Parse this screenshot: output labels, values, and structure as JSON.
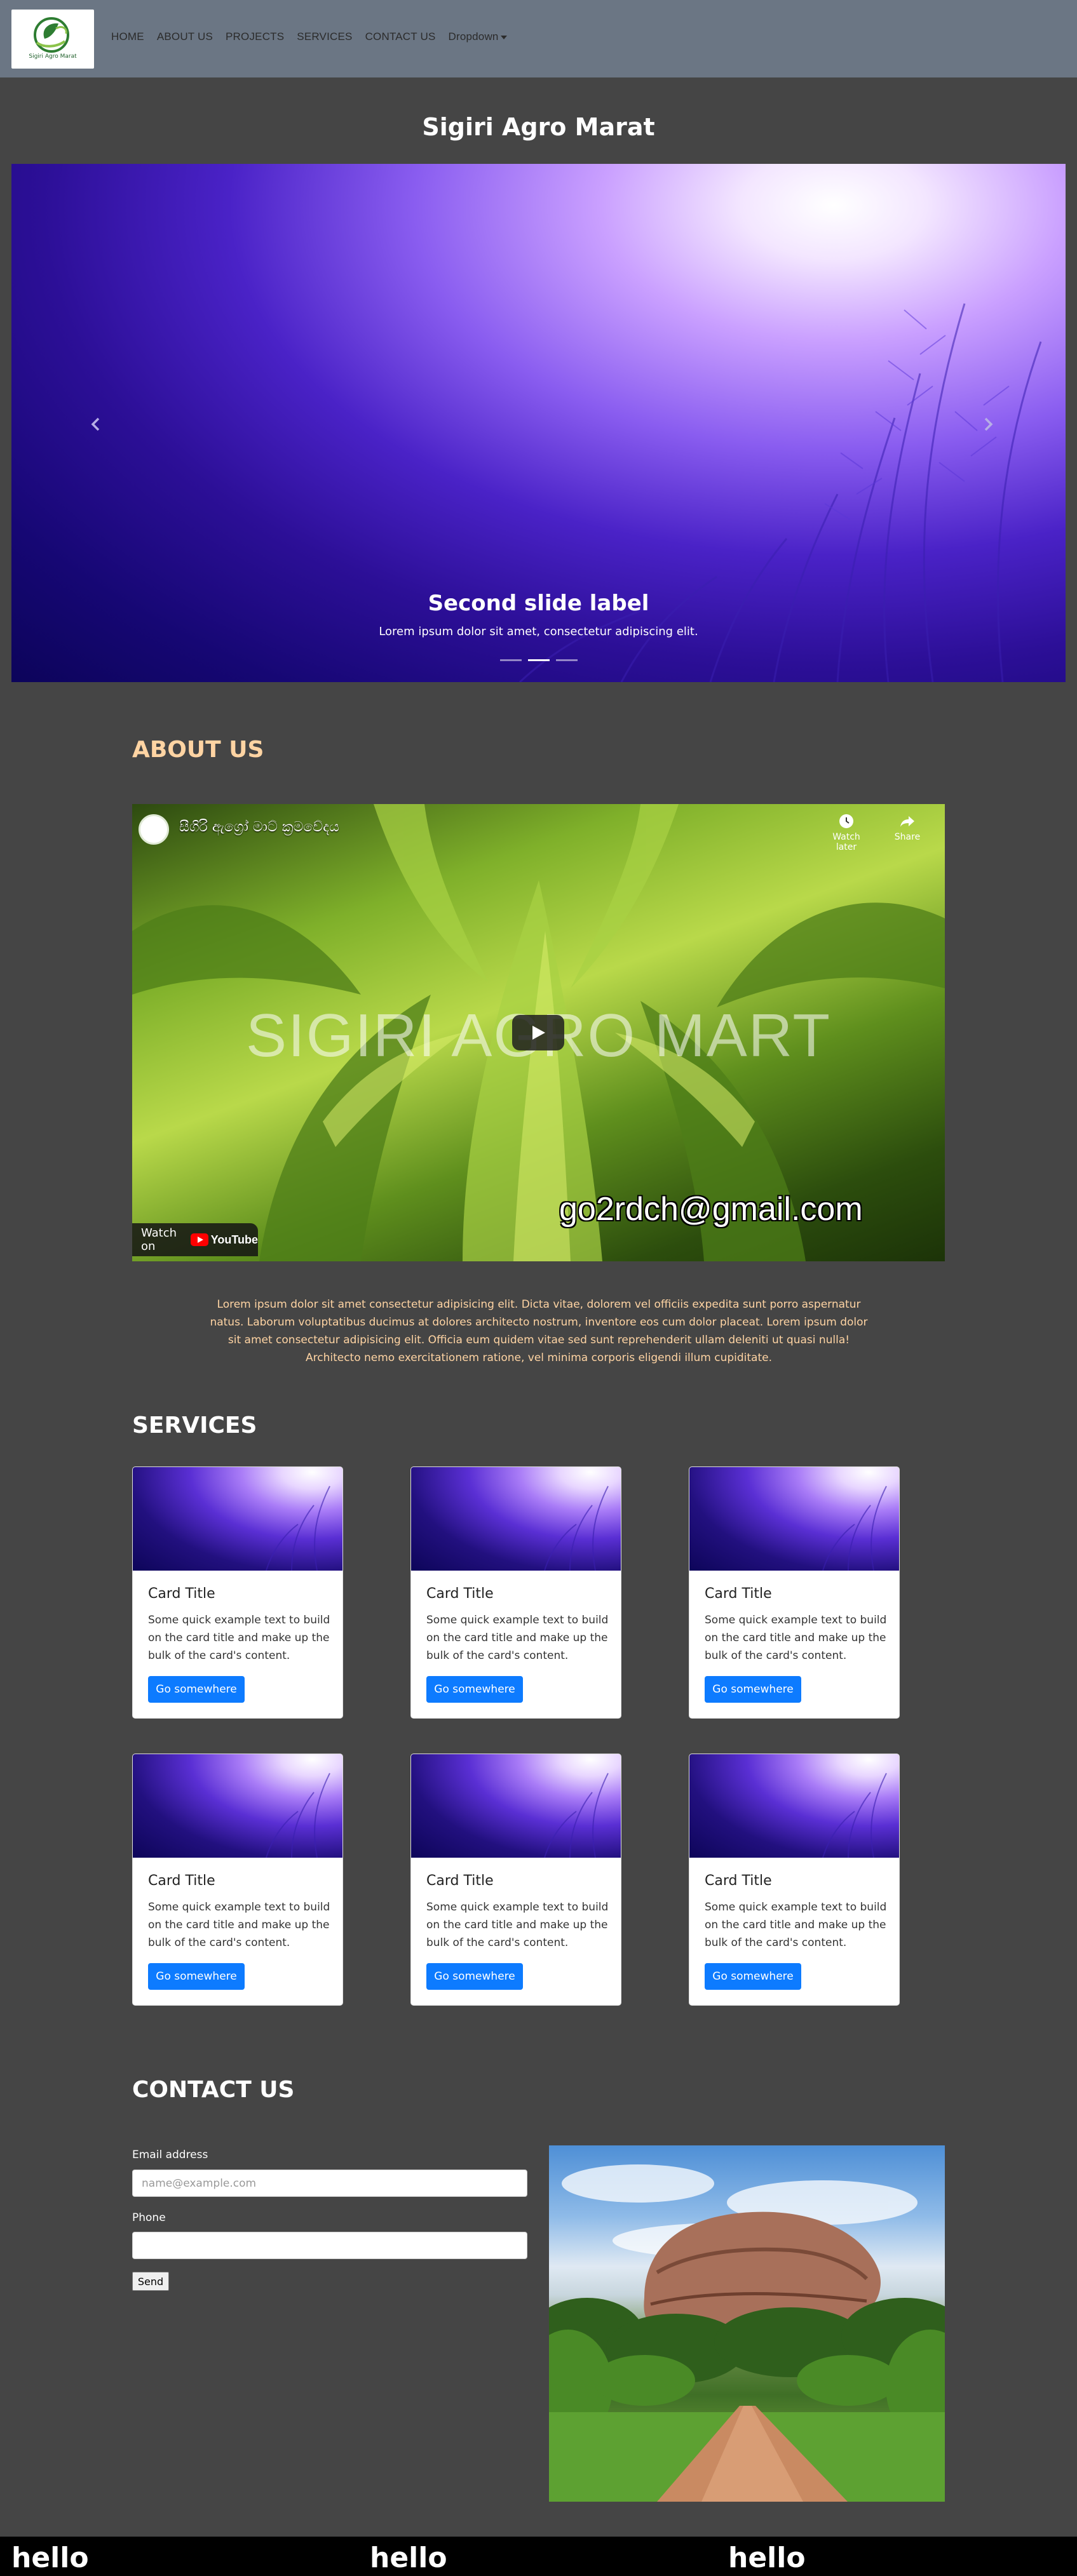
{
  "navbar": {
    "logo_text": "Sigiri Agro Marat",
    "items": [
      {
        "label": "HOME"
      },
      {
        "label": "ABOUT US"
      },
      {
        "label": "PROJECTS"
      },
      {
        "label": "SERVICES"
      },
      {
        "label": "CONTACT US"
      },
      {
        "label": "Dropdown"
      }
    ]
  },
  "site_title": "Sigiri Agro Marat",
  "carousel": {
    "slide_label": "Second slide label",
    "slide_description": "Lorem ipsum dolor sit amet, consectetur adipiscing elit.",
    "slide_count": 3,
    "active_slide": 2
  },
  "about": {
    "heading": "ABOUT US",
    "video": {
      "channel_title": "සීගිරි ඇග්‍රෝ මාට් ක්‍රමවේදය",
      "watch_later": "Watch later",
      "share": "Share",
      "overlay_text": "SIGIRI AGRO MART",
      "email_overlay": "go2rdch@gmail.com",
      "watch_on": "Watch on",
      "youtube": "YouTube"
    },
    "text": "Lorem ipsum dolor sit amet consectetur adipisicing elit. Dicta vitae, dolorem vel officiis expedita sunt porro aspernatur natus. Laborum voluptatibus ducimus at dolores architecto nostrum, inventore eos cum dolor placeat. Lorem ipsum dolor sit amet consectetur adipisicing elit. Officia eum quidem vitae sed sunt reprehenderit ullam deleniti ut quasi nulla! Architecto nemo exercitationem ratione, vel minima corporis eligendi illum cupiditate."
  },
  "services": {
    "heading": "SERVICES",
    "cards": [
      {
        "title": "Card Title",
        "text": "Some quick example text to build on the card title and make up the bulk of the card's content.",
        "button": "Go somewhere"
      },
      {
        "title": "Card Title",
        "text": "Some quick example text to build on the card title and make up the bulk of the card's content.",
        "button": "Go somewhere"
      },
      {
        "title": "Card Title",
        "text": "Some quick example text to build on the card title and make up the bulk of the card's content.",
        "button": "Go somewhere"
      },
      {
        "title": "Card Title",
        "text": "Some quick example text to build on the card title and make up the bulk of the card's content.",
        "button": "Go somewhere"
      },
      {
        "title": "Card Title",
        "text": "Some quick example text to build on the card title and make up the bulk of the card's content.",
        "button": "Go somewhere"
      },
      {
        "title": "Card Title",
        "text": "Some quick example text to build on the card title and make up the bulk of the card's content.",
        "button": "Go somewhere"
      }
    ]
  },
  "contact": {
    "heading": "CONTACT US",
    "email_label": "Email address",
    "email_placeholder": "name@example.com",
    "email_value": "",
    "phone_label": "Phone",
    "phone_value": "",
    "send_button": "Send"
  },
  "footer": {
    "items": [
      {
        "label": "hello"
      },
      {
        "label": "hello"
      },
      {
        "label": "hello"
      }
    ]
  }
}
